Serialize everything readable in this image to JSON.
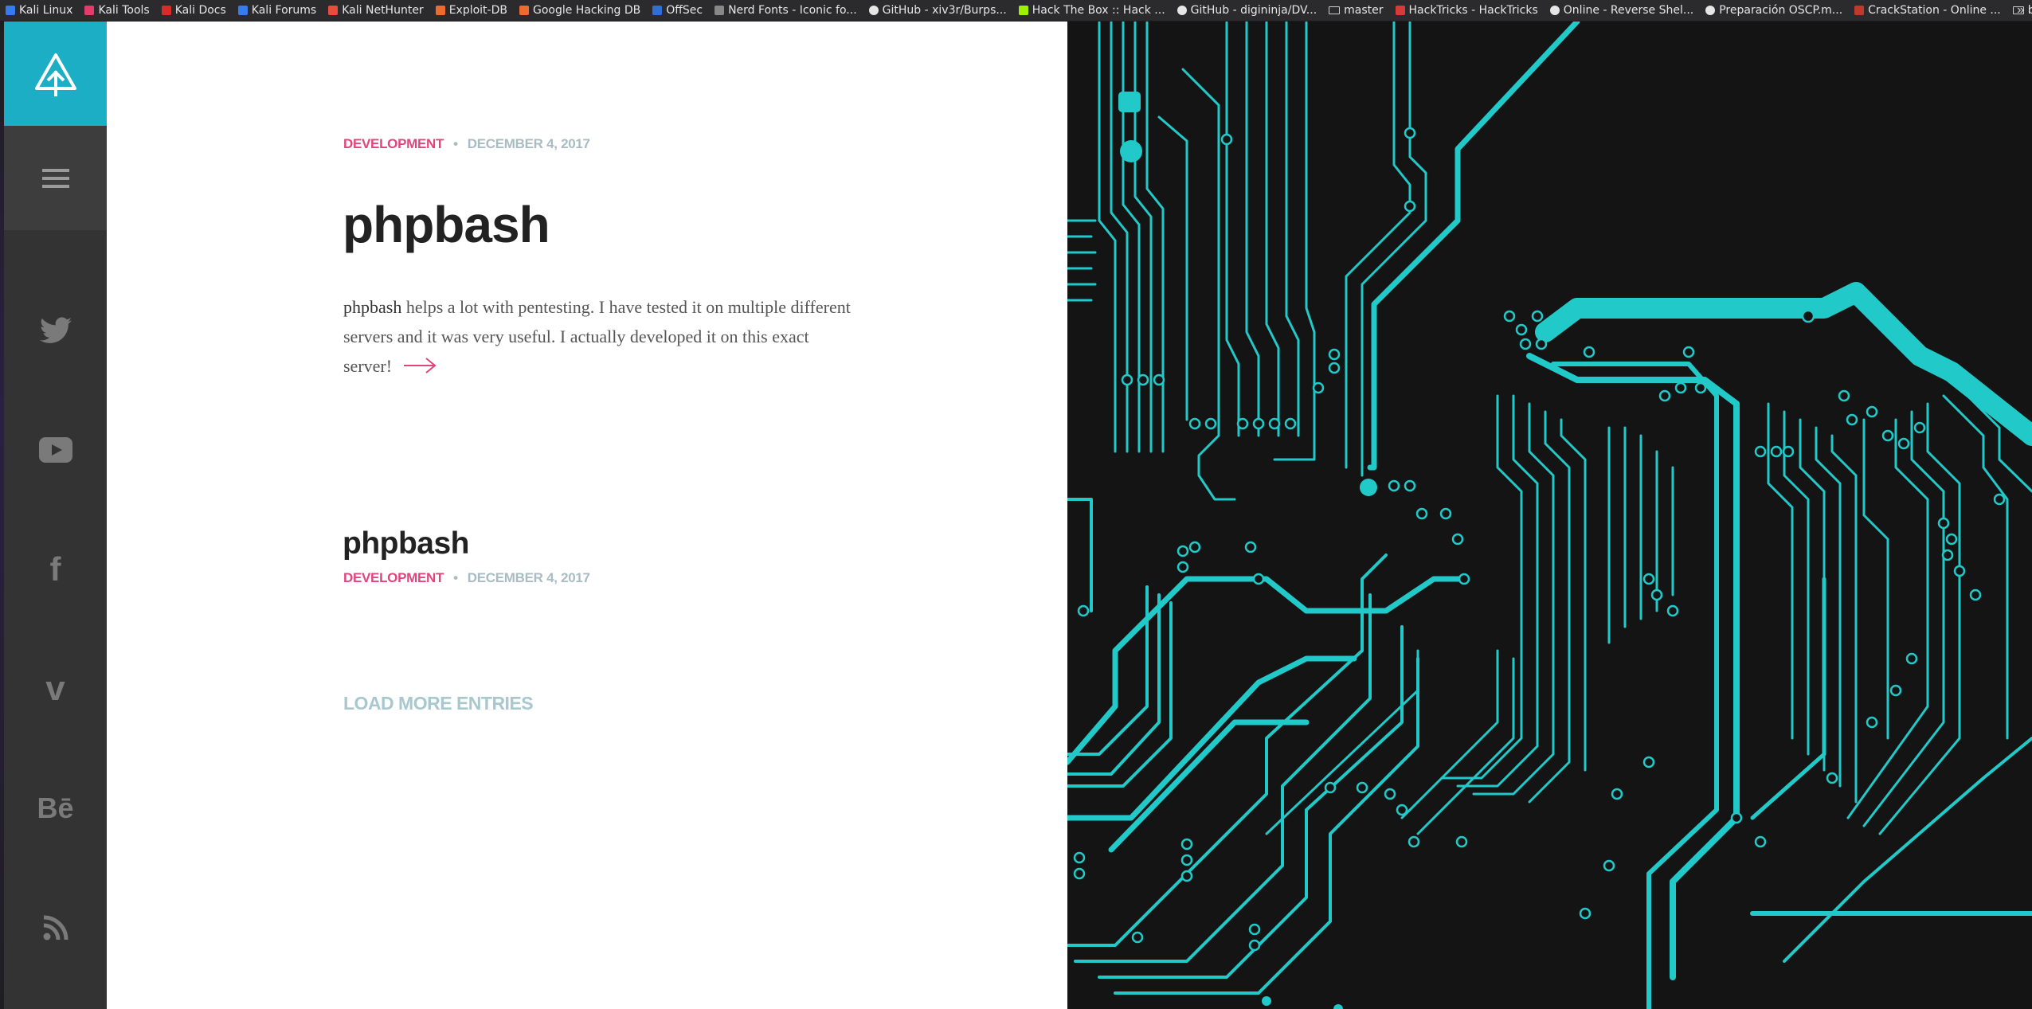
{
  "bookmarks": [
    {
      "label": "Kali Linux",
      "icon": "kali-dragon-icon",
      "color": "#367bf0"
    },
    {
      "label": "Kali Tools",
      "icon": "kali-tools-icon",
      "color": "#e43b6a"
    },
    {
      "label": "Kali Docs",
      "icon": "kali-docs-icon",
      "color": "#d92b2b"
    },
    {
      "label": "Kali Forums",
      "icon": "kali-forums-icon",
      "color": "#367bf0"
    },
    {
      "label": "Kali NetHunter",
      "icon": "nethunter-icon",
      "color": "#e84c3d"
    },
    {
      "label": "Exploit-DB",
      "icon": "exploit-db-icon",
      "color": "#ee6b2f"
    },
    {
      "label": "Google Hacking DB",
      "icon": "ghdb-icon",
      "color": "#ee6b2f"
    },
    {
      "label": "OffSec",
      "icon": "offsec-icon",
      "color": "#2f6fd6"
    },
    {
      "label": "Nerd Fonts - Iconic fo...",
      "icon": "nerd-fonts-icon",
      "color": "#888888"
    },
    {
      "label": "GitHub - xiv3r/Burps...",
      "icon": "github-icon",
      "color": "#e6e6e6"
    },
    {
      "label": "Hack The Box :: Hack ...",
      "icon": "hackthebox-icon",
      "color": "#9fef00"
    },
    {
      "label": "GitHub - digininja/DV...",
      "icon": "github-icon",
      "color": "#e6e6e6"
    },
    {
      "label": "master",
      "icon": "folder-icon",
      "color": "#cfcfcf"
    },
    {
      "label": "HackTricks - HackTricks",
      "icon": "hacktricks-icon",
      "color": "#d63a3a"
    },
    {
      "label": "Online - Reverse Shel...",
      "icon": "skull-icon",
      "color": "#e6e6e6"
    },
    {
      "label": "Preparación OSCP.m...",
      "icon": "github-icon",
      "color": "#e6e6e6"
    },
    {
      "label": "CrackStation - Online ...",
      "icon": "crackstation-icon",
      "color": "#c0392b"
    },
    {
      "label": "bugbounty",
      "icon": "folder-icon",
      "color": "#cfcfcf"
    }
  ],
  "bookmarks_overflow": "»",
  "sidebar": {
    "logo_icon": "tree-logo-icon",
    "menu_icon": "hamburger-menu-icon",
    "social": [
      {
        "name": "twitter",
        "icon": "twitter-icon"
      },
      {
        "name": "youtube",
        "icon": "youtube-icon"
      },
      {
        "name": "facebook",
        "icon": "facebook-icon",
        "glyph": "f"
      },
      {
        "name": "vimeo",
        "icon": "vimeo-icon",
        "glyph": "v"
      },
      {
        "name": "behance",
        "icon": "behance-icon",
        "glyph": "Bē"
      },
      {
        "name": "rss",
        "icon": "rss-icon"
      }
    ]
  },
  "post": {
    "category": "DEVELOPMENT",
    "separator": "•",
    "date": "DECEMBER 4, 2017",
    "title": "phpbash",
    "excerpt_bold": "phpbash",
    "excerpt_rest": " helps a lot with pentesting. I have tested it on multiple different servers and it was very useful. I actually developed it on this exact server!"
  },
  "post2": {
    "title": "phpbash",
    "category": "DEVELOPMENT",
    "separator": "•",
    "date": "DECEMBER 4, 2017"
  },
  "load_more": "LOAD MORE ENTRIES",
  "colors": {
    "accent": "#1baec4",
    "category": "#e0457b",
    "meta": "#a9bcc4",
    "sidebar": "#333333",
    "circuit": "#22c9c9",
    "circuit_bg": "#141414"
  }
}
